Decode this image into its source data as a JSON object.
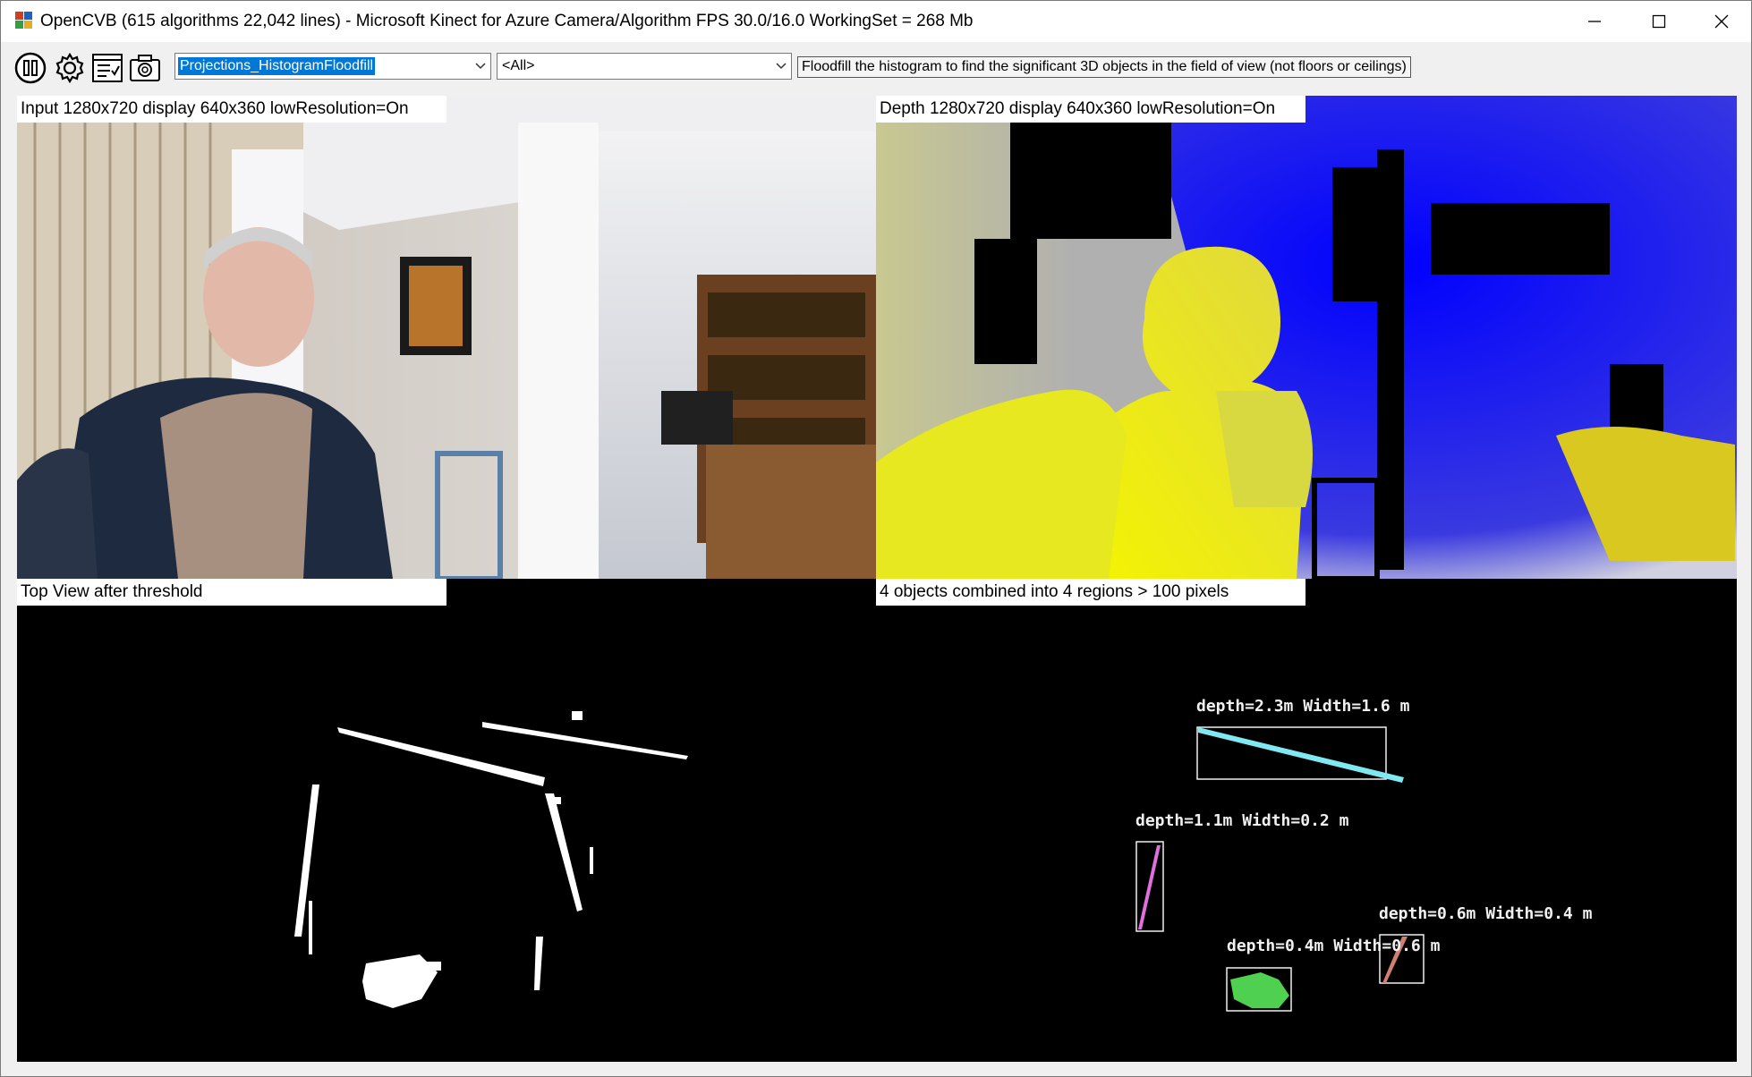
{
  "window": {
    "title": "OpenCVB (615 algorithms 22,042 lines) - Microsoft Kinect for Azure Camera/Algorithm FPS 30.0/16.0 WorkingSet = 268 Mb",
    "minimize_icon": "minimize-icon",
    "maximize_icon": "maximize-icon",
    "close_icon": "close-icon"
  },
  "toolbar": {
    "icons": [
      "pause-icon",
      "gear-icon",
      "checklist-icon",
      "camera-icon"
    ],
    "algorithm_select": {
      "value": "Projections_HistogramFloodfill"
    },
    "group_select": {
      "value": "<All>"
    },
    "description": "Floodfill the histogram to find the significant 3D objects in the field of view (not floors or ceilings)"
  },
  "panels": {
    "input_label": "Input  1280x720  display  640x360  lowResolution=On",
    "depth_label": "Depth  1280x720  display  640x360  lowResolution=On",
    "topview_label": "Top View after threshold",
    "objects_label": "4 objects combined into 4 regions > 100 pixels"
  },
  "objects": [
    {
      "label": "depth=2.3m  Width=1.6  m",
      "color": "#7fe8f0"
    },
    {
      "label": "depth=1.1m  Width=0.2  m",
      "color": "#e070e0"
    },
    {
      "label": "depth=0.6m  Width=0.4  m",
      "color": "#d08070"
    },
    {
      "label": "depth=0.4m  Width=0.6  m",
      "color": "#50d050"
    }
  ],
  "colors": {
    "selection": "#0078d7",
    "depth_near": "#f0f000",
    "depth_far": "#2020e0"
  }
}
